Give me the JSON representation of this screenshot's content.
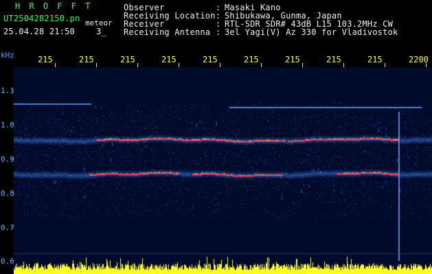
{
  "header": {
    "brand": "H R O F F T",
    "filename": "UT2504282150.pn",
    "mode": "meteor",
    "datetime": "25.04.28 21:50",
    "index": "3_",
    "observer_label": "Observer",
    "observer_value": "Masaki Kano",
    "location_label": "Receiving Location",
    "location_value": "Shibukawa, Gunma, Japan",
    "receiver_label": "Receiver",
    "receiver_value": "RTL-SDR SDR# 43dB L15 103.2MHz CW",
    "antenna_label": "Receiving Antenna",
    "antenna_value": "3el Yagi(V) Az 330 for Vladivostok",
    "separator": ":"
  },
  "axis": {
    "unit": "kHz",
    "y_labels": [
      "1.1",
      "1.0",
      "0.9",
      "0.8",
      "0.7",
      "0.6"
    ],
    "time_labels": [
      "215",
      "215",
      "215",
      "215",
      "215",
      "215",
      "215",
      "215",
      "215",
      "2200"
    ]
  },
  "colors": {
    "header_green": "#33ff55",
    "header_white": "#f2f2f2",
    "time_yellow": "#ffff44",
    "axis_blue": "#5f9cff",
    "spectrum_base": "#000a2a",
    "band_red": "#ff3b4f"
  }
}
